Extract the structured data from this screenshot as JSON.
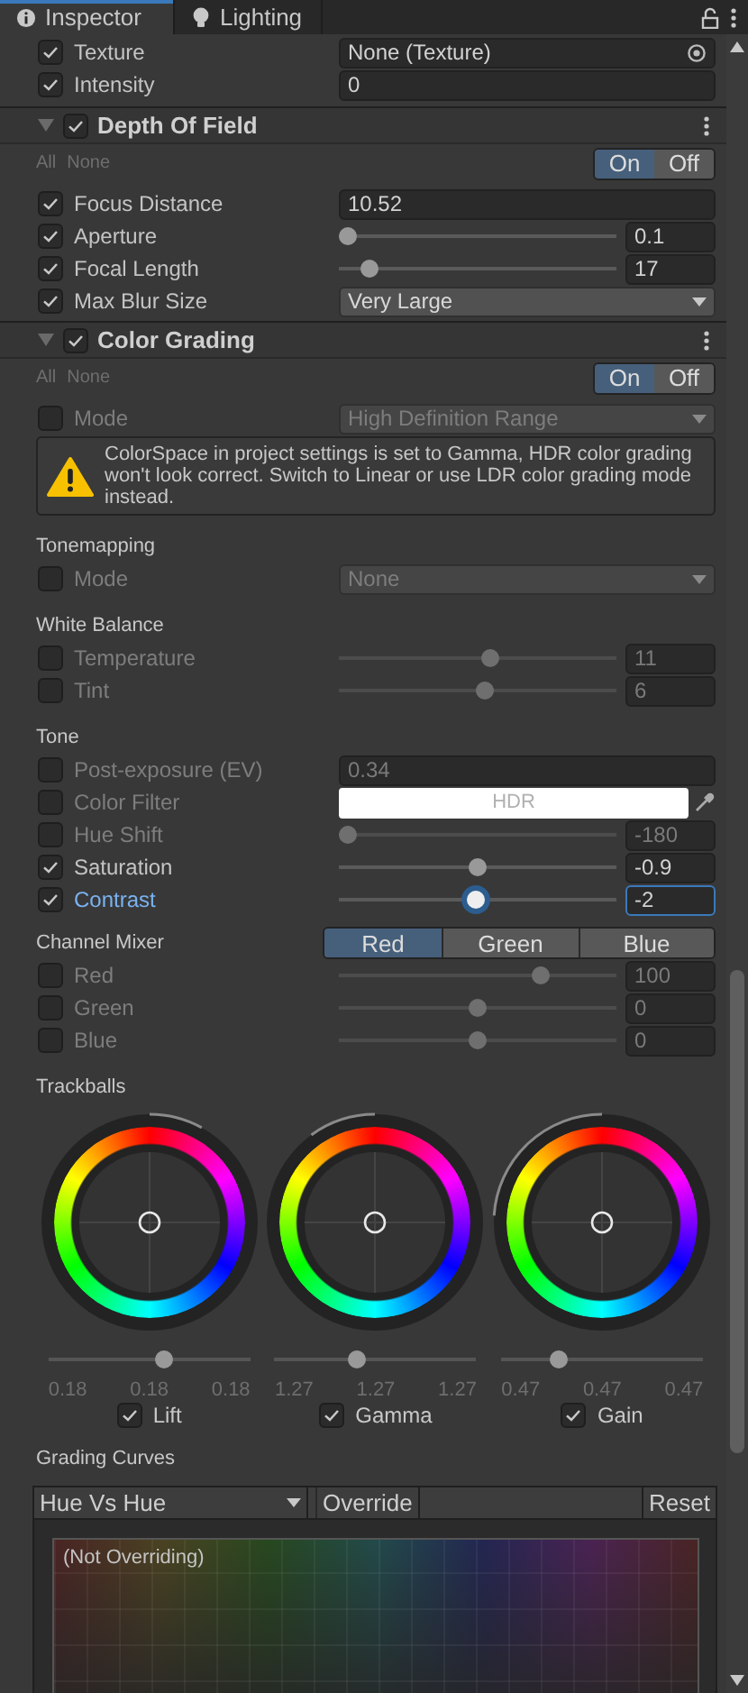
{
  "tabs": [
    {
      "label": "Inspector",
      "selected": true
    },
    {
      "label": "Lighting",
      "selected": false
    }
  ],
  "top_rows": [
    {
      "kind": "object",
      "label": "Texture",
      "checked": true,
      "value": "None (Texture)"
    },
    {
      "kind": "number",
      "label": "Intensity",
      "checked": true,
      "value": "0"
    }
  ],
  "sections": [
    {
      "title": "Depth Of Field",
      "enabled": true,
      "expanded": true,
      "all": "All",
      "none": "None",
      "toggle": [
        {
          "label": "On",
          "selected": true
        },
        {
          "label": "Off",
          "selected": false
        }
      ],
      "items": [
        {
          "kind": "number",
          "label": "Focus Distance",
          "checked": true,
          "value": "10.52"
        },
        {
          "kind": "slider",
          "label": "Aperture",
          "checked": true,
          "level": 0.0,
          "value": "0.1"
        },
        {
          "kind": "slider",
          "label": "Focal Length",
          "checked": true,
          "level": 0.08,
          "value": "17"
        },
        {
          "kind": "dropdown",
          "label": "Max Blur Size",
          "checked": true,
          "value": "Very Large"
        }
      ]
    },
    {
      "title": "Color Grading",
      "enabled": true,
      "expanded": true,
      "all": "All",
      "none": "None",
      "toggle": [
        {
          "label": "On",
          "selected": true
        },
        {
          "label": "Off",
          "selected": false
        }
      ],
      "items": [
        {
          "kind": "dropdown",
          "label": "Mode",
          "checked": false,
          "value": "High Definition Range"
        },
        {
          "kind": "warning",
          "text": "ColorSpace in project settings is set to Gamma, HDR color grading won't look correct. Switch to Linear or use LDR color grading mode instead."
        },
        {
          "kind": "heading",
          "label": "Tonemapping"
        },
        {
          "kind": "dropdown",
          "label": "Mode",
          "checked": false,
          "value": "None"
        },
        {
          "kind": "heading",
          "label": "White Balance"
        },
        {
          "kind": "slider",
          "label": "Temperature",
          "checked": false,
          "level": 0.55,
          "value": "11"
        },
        {
          "kind": "slider",
          "label": "Tint",
          "checked": false,
          "level": 0.53,
          "value": "6"
        },
        {
          "kind": "heading",
          "label": "Tone"
        },
        {
          "kind": "number",
          "label": "Post-exposure (EV)",
          "checked": false,
          "value": "0.34"
        },
        {
          "kind": "color",
          "label": "Color Filter",
          "checked": false,
          "value": "HDR",
          "color": "#ffffff"
        },
        {
          "kind": "slider",
          "label": "Hue Shift",
          "checked": false,
          "level": 0.0,
          "value": "-180"
        },
        {
          "kind": "slider",
          "label": "Saturation",
          "checked": true,
          "level": 0.5,
          "value": "-0.9"
        },
        {
          "kind": "slider",
          "label": "Contrast",
          "checked": true,
          "focused": true,
          "level": 0.49,
          "value": "-2"
        },
        {
          "kind": "segmented",
          "label": "Channel Mixer",
          "options": [
            {
              "label": "Red",
              "selected": true
            },
            {
              "label": "Green",
              "selected": false
            },
            {
              "label": "Blue",
              "selected": false
            }
          ]
        },
        {
          "kind": "slider",
          "label": "Red",
          "checked": false,
          "level": 0.74,
          "value": "100"
        },
        {
          "kind": "slider",
          "label": "Green",
          "checked": false,
          "level": 0.5,
          "value": "0"
        },
        {
          "kind": "slider",
          "label": "Blue",
          "checked": false,
          "level": 0.5,
          "value": "0"
        },
        {
          "kind": "heading",
          "label": "Trackballs"
        },
        {
          "kind": "trackballs",
          "balls": [
            {
              "label": "Lift",
              "checked": true,
              "level": 0.58,
              "values": [
                "0.18",
                "0.18",
                "0.18"
              ]
            },
            {
              "label": "Gamma",
              "checked": true,
              "level": 0.4,
              "values": [
                "1.27",
                "1.27",
                "1.27"
              ]
            },
            {
              "label": "Gain",
              "checked": true,
              "level": 0.26,
              "values": [
                "0.47",
                "0.47",
                "0.47"
              ]
            }
          ]
        },
        {
          "kind": "heading",
          "label": "Grading Curves"
        },
        {
          "kind": "curves",
          "mode": "Hue Vs Hue",
          "override": "Override",
          "reset": "Reset",
          "overlay": "(Not Overriding)"
        }
      ]
    }
  ]
}
